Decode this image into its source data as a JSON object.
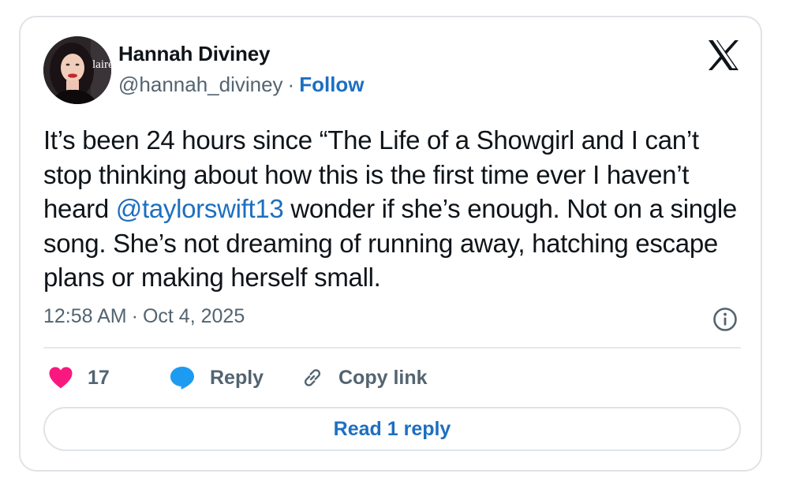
{
  "author": {
    "name": "Hannah Diviney",
    "handle": "@hannah_diviney",
    "separator": "·",
    "follow_label": "Follow",
    "avatar_text": "laire"
  },
  "tweet": {
    "text_before": "It’s been 24 hours since “The Life of a Showgirl and I can’t stop thinking about how this is the first time ever I haven’t heard ",
    "mention": "@taylorswift13",
    "text_after": " wonder if she’s enough. Not on a single song. She’s not dreaming of running away, hatching escape plans or making herself small."
  },
  "timestamp": {
    "time": "12:58 AM",
    "separator": "·",
    "date": "Oct 4, 2025"
  },
  "actions": {
    "like_count": "17",
    "reply_label": "Reply",
    "copy_link_label": "Copy link"
  },
  "read_replies_label": "Read 1 reply",
  "colors": {
    "link_blue": "#1d6fc1",
    "like_pink": "#f91880",
    "reply_blue": "#1d9bf0",
    "muted_text": "#536471",
    "border": "#dfe3e7"
  },
  "icons": {
    "brand": "x-logo-icon",
    "info": "info-icon",
    "like": "heart-icon",
    "reply": "speech-bubble-icon",
    "copy_link": "link-icon"
  }
}
